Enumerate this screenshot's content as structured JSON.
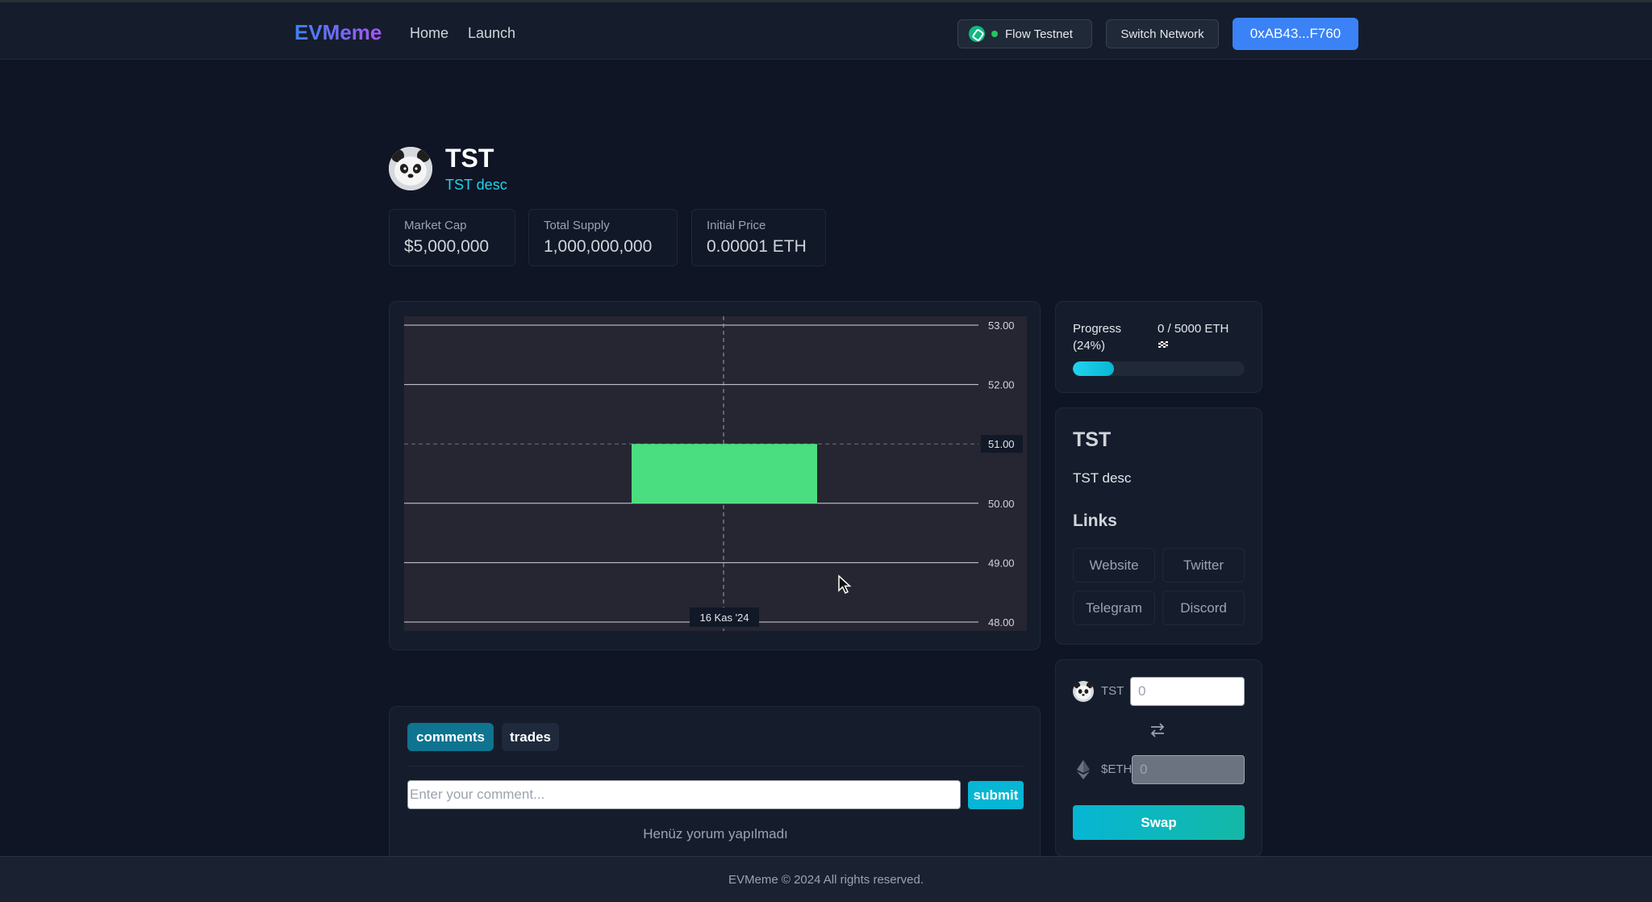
{
  "navbar": {
    "brand": "EVMeme",
    "links": {
      "home": "Home",
      "launch": "Launch"
    },
    "network": "Flow Testnet",
    "switch_network": "Switch Network",
    "wallet_address": "0xAB43...F760"
  },
  "token": {
    "name": "TST",
    "description": "TST desc",
    "avatar_icon": "panda-icon"
  },
  "stats": {
    "market_cap": {
      "label": "Market Cap",
      "value": "$5,000,000"
    },
    "total_supply": {
      "label": "Total Supply",
      "value": "1,000,000,000"
    },
    "initial_price": {
      "label": "Initial Price",
      "value": "0.00001 ETH"
    }
  },
  "chart_data": {
    "type": "candlestick",
    "y_ticks": [
      "53.00",
      "52.00",
      "51.00",
      "50.00",
      "49.00",
      "48.00"
    ],
    "ylim": [
      47.85,
      53.15
    ],
    "crosshair_price": "51.00",
    "crosshair_time": "16 Kas '24",
    "candles": [
      {
        "time": "16 Kas '24",
        "open": 50,
        "high": 51,
        "low": 50,
        "close": 51,
        "color": "#4ade80"
      }
    ],
    "colors": {
      "background": "#252631",
      "grid": "#d1d5db",
      "up": "#4ade80"
    }
  },
  "progress": {
    "label": "Progress (24%)",
    "value": "0 / 5000 ETH",
    "flag_icon": "checkered-flag-icon",
    "percent": 24
  },
  "info": {
    "title": "TST",
    "description": "TST desc",
    "links_title": "Links",
    "links": [
      "Website",
      "Twitter",
      "Telegram",
      "Discord"
    ]
  },
  "swap": {
    "from_symbol": "TST",
    "from_placeholder": "0",
    "to_symbol": "$ETH",
    "to_placeholder": "0",
    "button": "Swap"
  },
  "comments": {
    "tabs": [
      "comments",
      "trades"
    ],
    "active_tab": "comments",
    "input_placeholder": "Enter your comment...",
    "submit": "submit",
    "empty": "Henüz yorum yapılmadı"
  },
  "footer": {
    "text": "EVMeme © 2024 All rights reserved."
  },
  "colors": {
    "background": "#0f1524",
    "card": "#151d2c",
    "accent_cyan": "#06b6d4",
    "wallet_blue": "#3b82f6",
    "candle_green": "#4ade80"
  }
}
